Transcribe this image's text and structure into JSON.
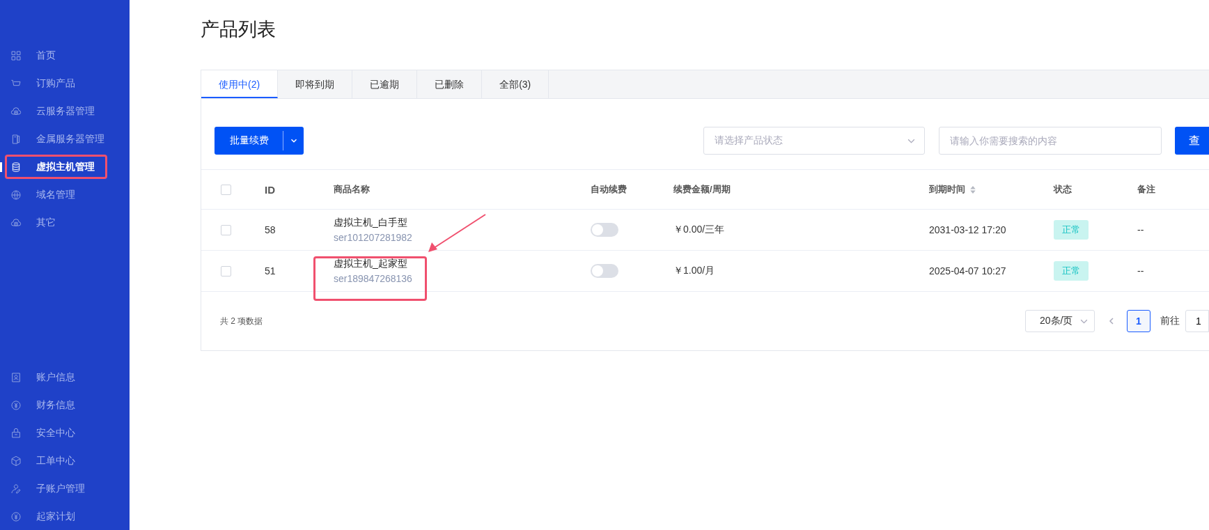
{
  "sidebar": {
    "items": [
      {
        "label": "首页",
        "selected": false,
        "highlighted": false
      },
      {
        "label": "订购产品",
        "selected": false,
        "highlighted": false
      },
      {
        "label": "云服务器管理",
        "selected": false,
        "highlighted": false
      },
      {
        "label": "金属服务器管理",
        "selected": false,
        "highlighted": false
      },
      {
        "label": "虚拟主机管理",
        "selected": true,
        "highlighted": true
      },
      {
        "label": "域名管理",
        "selected": false,
        "highlighted": false
      },
      {
        "label": "其它",
        "selected": false,
        "highlighted": false
      }
    ],
    "bottom_items": [
      {
        "label": "账户信息",
        "selected": false
      },
      {
        "label": "财务信息",
        "selected": false
      },
      {
        "label": "安全中心",
        "selected": false
      },
      {
        "label": "工单中心",
        "selected": false
      },
      {
        "label": "子账户管理",
        "selected": false
      },
      {
        "label": "起家计划",
        "selected": false
      }
    ]
  },
  "page_title": "产品列表",
  "tabs": [
    {
      "label": "使用中(2)",
      "selected": true
    },
    {
      "label": "即将到期",
      "selected": false
    },
    {
      "label": "已逾期",
      "selected": false
    },
    {
      "label": "已删除",
      "selected": false
    },
    {
      "label": "全部(3)",
      "selected": false
    }
  ],
  "toolbar": {
    "batch_button": "批量续费",
    "status_select": {
      "placeholder": "请选择产品状态"
    },
    "search": {
      "placeholder": "请输入你需要搜索的内容"
    },
    "query_button": "查"
  },
  "table": {
    "all_checked": false,
    "columns": [
      {
        "label": "ID",
        "sortable": false
      },
      {
        "label": "商品名称",
        "sortable": false
      },
      {
        "label": "自动续费",
        "sortable": false
      },
      {
        "label": "续费金额/周期",
        "sortable": false
      },
      {
        "label": "到期时间",
        "sortable": true
      },
      {
        "label": "状态",
        "sortable": false
      },
      {
        "label": "备注",
        "sortable": false
      }
    ],
    "rows": [
      {
        "checked": false,
        "id": "58",
        "name": "虚拟主机_白手型",
        "code": "ser101207281982",
        "auto_renew": false,
        "amount": "￥0.00/三年",
        "due": "2031-03-12 17:20",
        "status": "正常",
        "notes": "--",
        "highlighted": false
      },
      {
        "checked": false,
        "id": "51",
        "name": "虚拟主机_起家型",
        "code": "ser189847268136",
        "auto_renew": false,
        "amount": "￥1.00/月",
        "due": "2025-04-07 10:27",
        "status": "正常",
        "notes": "--",
        "highlighted": true
      }
    ]
  },
  "footer": {
    "total": "共 2 项数据",
    "page_size": "20条/页",
    "pages": [
      {
        "label": "1",
        "selected": true
      }
    ],
    "goto_label": "前往",
    "goto_value": "1"
  }
}
